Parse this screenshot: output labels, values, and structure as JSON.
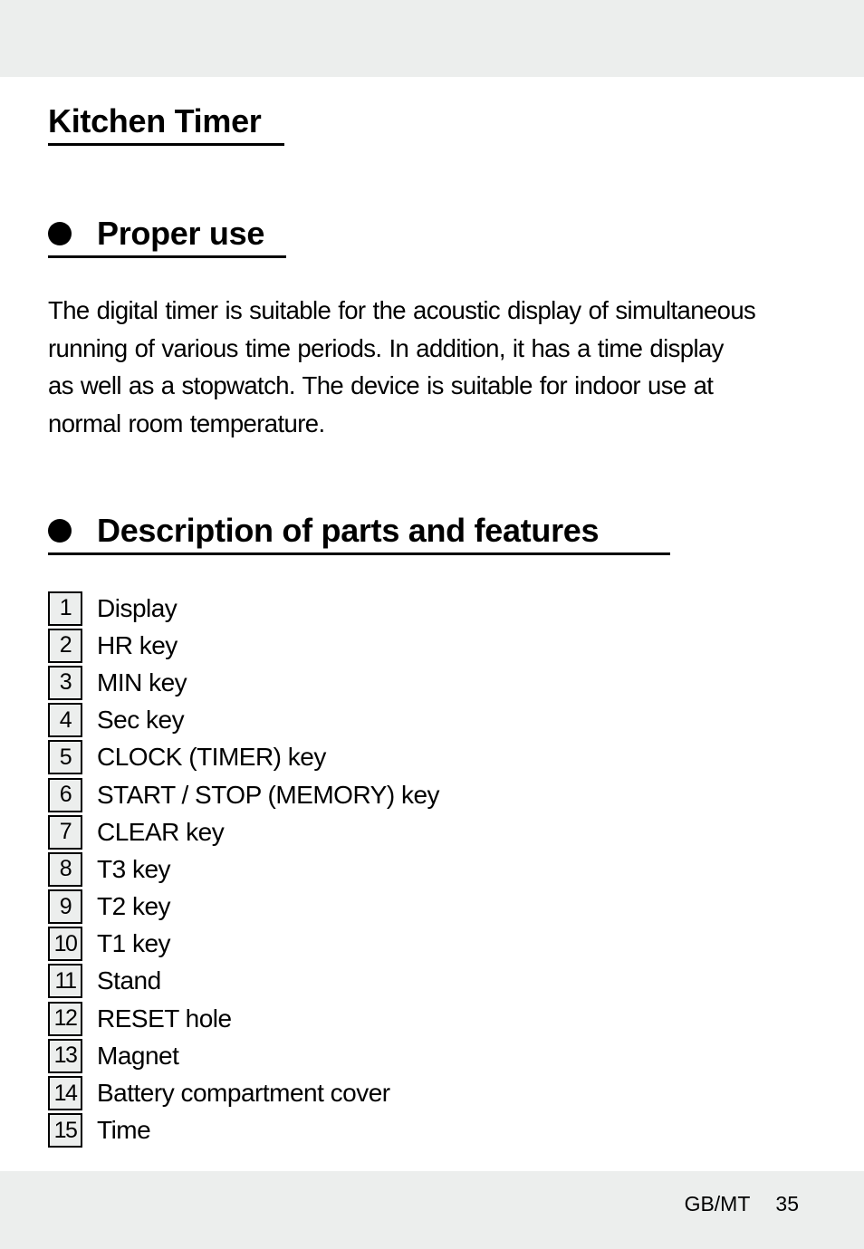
{
  "document": {
    "title": "Kitchen Timer",
    "sections": [
      {
        "heading": "Proper use",
        "paragraph_lines": [
          "The digital timer is suitable for the acoustic display of simultaneous",
          "running of various time periods. In addition, it has a time display",
          "as well as a stopwatch. The device is suitable for indoor use at",
          "normal room temperature."
        ]
      },
      {
        "heading": "Description of parts and features",
        "parts": [
          {
            "number": "1",
            "label": "Display"
          },
          {
            "number": "2",
            "label": "HR key"
          },
          {
            "number": "3",
            "label": "MIN key"
          },
          {
            "number": "4",
            "label": "Sec key"
          },
          {
            "number": "5",
            "label": "CLOCK (TIMER) key"
          },
          {
            "number": "6",
            "label": "START / STOP (MEMORY) key"
          },
          {
            "number": "7",
            "label": "CLEAR key"
          },
          {
            "number": "8",
            "label": "T3 key"
          },
          {
            "number": "9",
            "label": "T2 key"
          },
          {
            "number": "10",
            "label": "T1 key"
          },
          {
            "number": "11",
            "label": "Stand"
          },
          {
            "number": "12",
            "label": "RESET hole"
          },
          {
            "number": "13",
            "label": "Magnet"
          },
          {
            "number": "14",
            "label": "Battery compartment cover"
          },
          {
            "number": "15",
            "label": "Time"
          }
        ]
      }
    ]
  },
  "footer": {
    "language_code": "GB/MT",
    "page_number": "35"
  },
  "colors": {
    "band_background": "#eceeed",
    "text": "#000000"
  }
}
